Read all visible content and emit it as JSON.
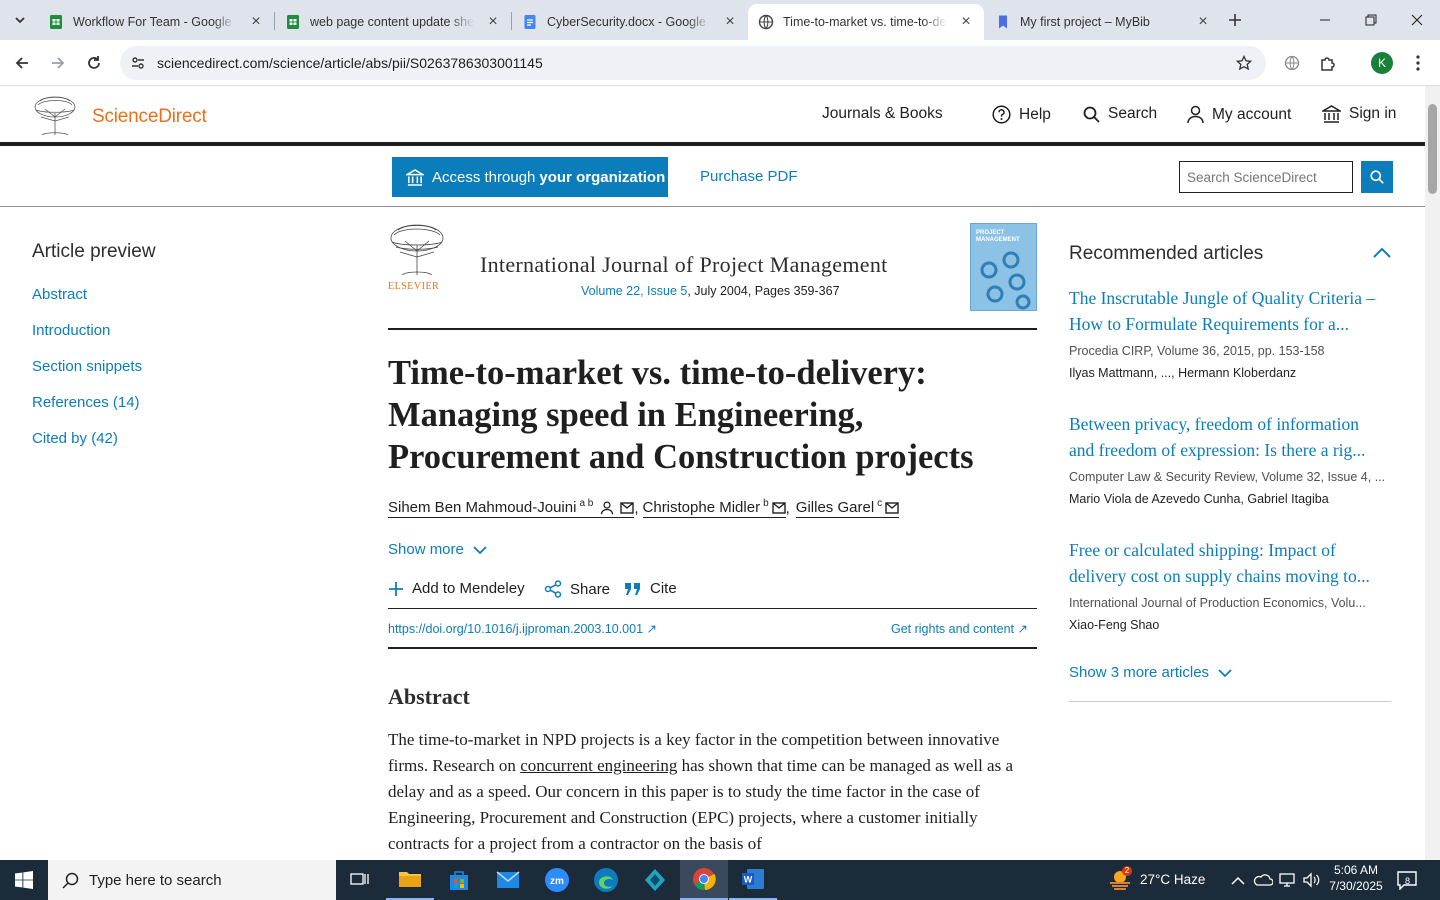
{
  "browser": {
    "tabs": [
      {
        "title": "Workflow For Team - Google Sheets",
        "icon": "sheets-icon"
      },
      {
        "title": "web page content update sheet",
        "icon": "sheets-icon"
      },
      {
        "title": "CyberSecurity.docx - Google Docs",
        "icon": "docs-icon"
      },
      {
        "title": "Time-to-market vs. time-to-delivery",
        "icon": "globe-icon"
      },
      {
        "title": "My first project – MyBib",
        "icon": "bookmark-icon"
      }
    ],
    "url": "sciencedirect.com/science/article/abs/pii/S0263786303001145",
    "profile_initial": "K"
  },
  "site": {
    "brand": "ScienceDirect",
    "elsevier": "ELSEVIER",
    "nav": {
      "journals": "Journals & Books",
      "help": "Help",
      "search": "Search",
      "account": "My account",
      "signin": "Sign in"
    },
    "access": {
      "prefix": "Access through",
      "bold": "your organization"
    },
    "purchase": "Purchase PDF",
    "search_placeholder": "Search ScienceDirect"
  },
  "sidebar": {
    "heading": "Article preview",
    "items": [
      "Abstract",
      "Introduction",
      "Section snippets",
      "References (14)",
      "Cited by (42)"
    ]
  },
  "article": {
    "journal": "International Journal of Project Management",
    "volume_link": "Volume 22, Issue 5",
    "volume_rest": ", July 2004, Pages 359-367",
    "cover_text": "PROJECT MANAGEMENT",
    "title": "Time-to-market vs. time-to-delivery: Managing speed in Engineering, Procurement and Construction projects",
    "authors": [
      {
        "name": "Sihem Ben Mahmoud-Jouini",
        "sup": "a b"
      },
      {
        "name": "Christophe Midler",
        "sup": "b"
      },
      {
        "name": "Gilles Garel",
        "sup": "c"
      }
    ],
    "show_more": "Show more",
    "actions": {
      "mendeley": "Add to Mendeley",
      "share": "Share",
      "cite": "Cite"
    },
    "doi": "https://doi.org/10.1016/j.ijproman.2003.10.001",
    "rights": "Get rights and content",
    "abstract_heading": "Abstract",
    "abstract_1": "The time-to-market in NPD projects is a key factor in the competition between innovative firms. Research on ",
    "abstract_link": "concurrent engineering",
    "abstract_2": " has shown that time can be managed as well as a delay and as a speed. Our concern in this paper is to study the time factor in the case of Engineering, Procurement and Construction (EPC) projects, where a customer initially contracts for a project from a contractor on the basis of"
  },
  "recommended": {
    "heading": "Recommended articles",
    "items": [
      {
        "title_1": "The Inscrutable Jungle of Quality Criteria –",
        "title_2": "How to Formulate Requirements for a...",
        "source": "Procedia CIRP, Volume 36, 2015, pp. 153-158",
        "authors": "Ilyas Mattmann, ..., Hermann Kloberdanz"
      },
      {
        "title_1": "Between privacy, freedom of information",
        "title_2": "and freedom of expression: Is there a rig...",
        "source": "Computer Law & Security Review, Volume 32, Issue 4, ...",
        "authors": "Mario Viola de Azevedo Cunha, Gabriel Itagiba"
      },
      {
        "title_1": "Free or calculated shipping: Impact of",
        "title_2": "delivery cost on supply chains moving to...",
        "source": "International Journal of Production Economics, Volu...",
        "authors": "Xiao-Feng Shao"
      }
    ],
    "show_more": "Show 3 more articles"
  },
  "taskbar": {
    "search_placeholder": "Type here to search",
    "weather": "27°C  Haze",
    "weather_badge": "2",
    "time": "5:06 AM",
    "date": "7/30/2025",
    "notif_count": "8"
  },
  "colors": {
    "link": "#0c7dbb",
    "brand": "#e9711c",
    "taskbar": "#1c2b3a"
  }
}
